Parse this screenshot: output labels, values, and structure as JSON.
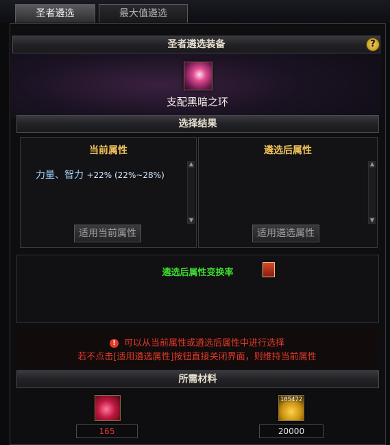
{
  "tabs": [
    {
      "label": "圣者遴选",
      "active": true
    },
    {
      "label": "最大值遴选",
      "active": false
    }
  ],
  "equipment_section": {
    "title": "圣者遴选装备",
    "help_label": "?",
    "item_name": "支配黑暗之环",
    "item_icon": "ring-icon"
  },
  "result_section": {
    "title": "选择结果",
    "current": {
      "title": "当前属性",
      "attribute_name": "力量、智力",
      "attribute_value": "+22% (22%~28%)",
      "apply_button": "适用当前属性"
    },
    "selected": {
      "title": "遴选后属性",
      "attribute_name": "",
      "apply_button": "适用遴选属性"
    }
  },
  "rate_section": {
    "title": "遴选后属性变换率",
    "icon": "book-icon"
  },
  "notice": {
    "line1": "可以从当前属性或遴选后属性中进行选择",
    "line2": "若不点击[适用遴选属性]按钮直接关闭界面，则维持当前属性",
    "icon": "warning-icon"
  },
  "materials": {
    "title": "所需材料",
    "items": [
      {
        "icon": "crystal-icon",
        "quantity": "165",
        "quantity_color": "#e23a2a"
      },
      {
        "icon": "gold-coins-icon",
        "owned": "105472",
        "quantity": "20000",
        "quantity_color": "#e8e8e8"
      }
    ]
  },
  "colors": {
    "header_text": "#e8e0d0",
    "panel_title": "#f2c25a",
    "rate_title": "#3ddc2f",
    "notice_text": "#e23a2a"
  }
}
